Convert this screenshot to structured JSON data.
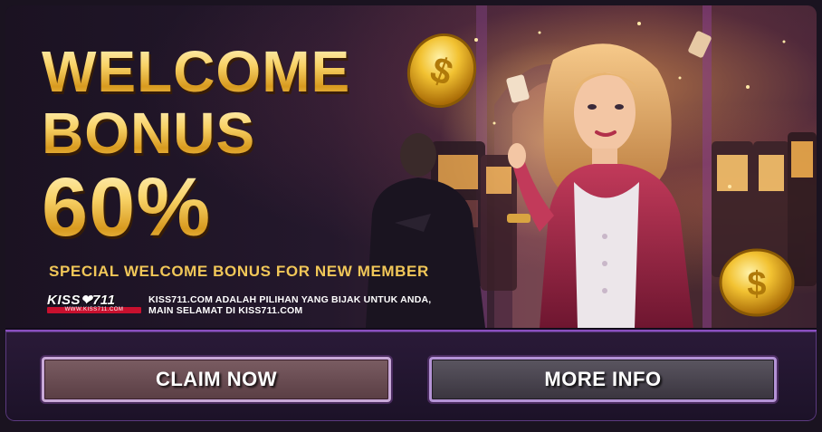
{
  "banner": {
    "headline_line1": "WELCOME",
    "headline_line2": "BONUS",
    "headline_line3": "60%",
    "subtitle": "SPECIAL WELCOME BONUS FOR NEW MEMBER",
    "brand": {
      "logo_text": "KISS❤711",
      "logo_url": "WWW.KISS711.COM",
      "tagline_line1": "KISS711.COM ADALAH PILIHAN YANG BIJAK UNTUK ANDA,",
      "tagline_line2": "MAIN SELAMAT DI KISS711.COM"
    }
  },
  "actions": {
    "claim_label": "CLAIM NOW",
    "more_info_label": "MORE INFO"
  },
  "colors": {
    "gold_accent": "#f5c24a",
    "brand_red": "#c8102e",
    "panel_border": "#8a4fc0"
  }
}
